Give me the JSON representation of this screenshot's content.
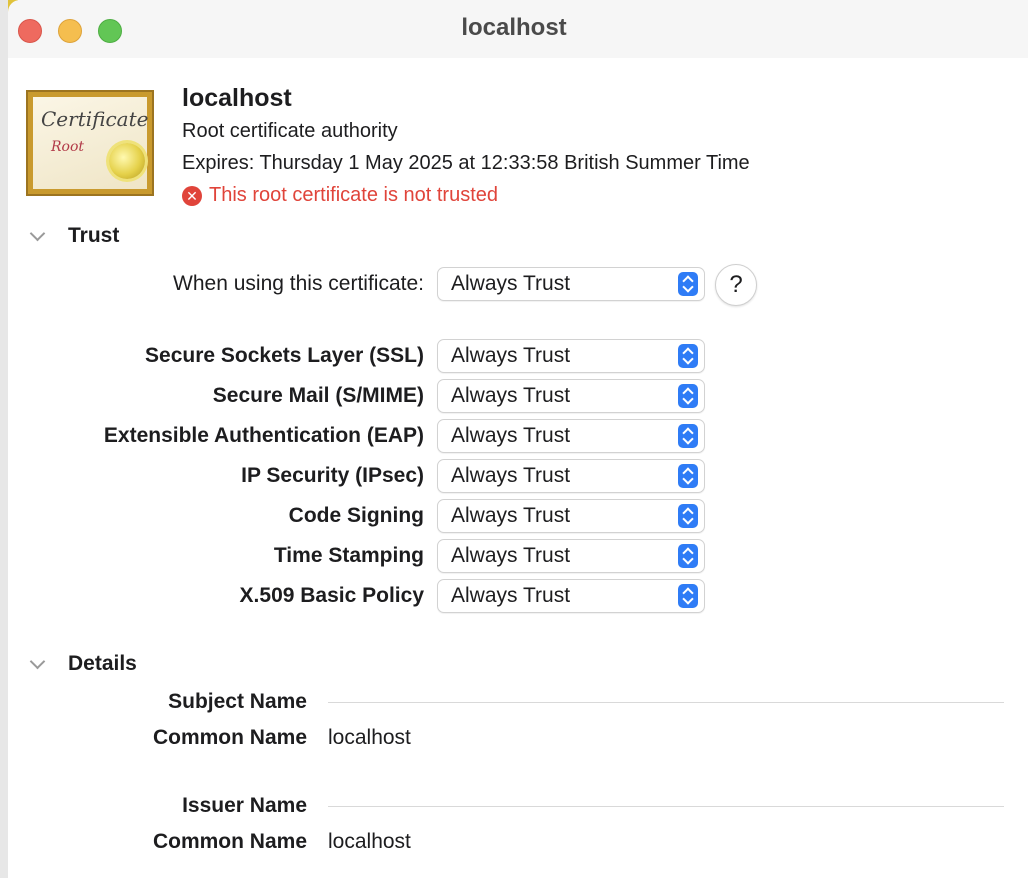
{
  "window": {
    "title": "localhost",
    "behind_title": "localhost"
  },
  "header": {
    "name": "localhost",
    "kind": "Root certificate authority",
    "expires": "Expires: Thursday 1 May 2025 at 12:33:58 British Summer Time",
    "warning": "This root certificate is not trusted",
    "warning_color": "#e0443a",
    "icon": {
      "name": "certificate-icon",
      "word": "Certificate",
      "sub": "Root"
    }
  },
  "trust": {
    "section_title": "Trust",
    "when_using_label": "When using this certificate:",
    "when_using_value": "Always Trust",
    "help_label": "?",
    "policies": [
      {
        "label": "Secure Sockets Layer (SSL)",
        "value": "Always Trust"
      },
      {
        "label": "Secure Mail (S/MIME)",
        "value": "Always Trust"
      },
      {
        "label": "Extensible Authentication (EAP)",
        "value": "Always Trust"
      },
      {
        "label": "IP Security (IPsec)",
        "value": "Always Trust"
      },
      {
        "label": "Code Signing",
        "value": "Always Trust"
      },
      {
        "label": "Time Stamping",
        "value": "Always Trust"
      },
      {
        "label": "X.509 Basic Policy",
        "value": "Always Trust"
      }
    ]
  },
  "details": {
    "section_title": "Details",
    "subject_heading": "Subject Name",
    "subject_cn_label": "Common Name",
    "subject_cn_value": "localhost",
    "issuer_heading": "Issuer Name",
    "issuer_cn_label": "Common Name",
    "issuer_cn_value": "localhost"
  },
  "colors": {
    "accent": "#2f7cf6",
    "close": "#ee6a5f",
    "minimize": "#f5be4f",
    "maximize": "#62c655"
  }
}
